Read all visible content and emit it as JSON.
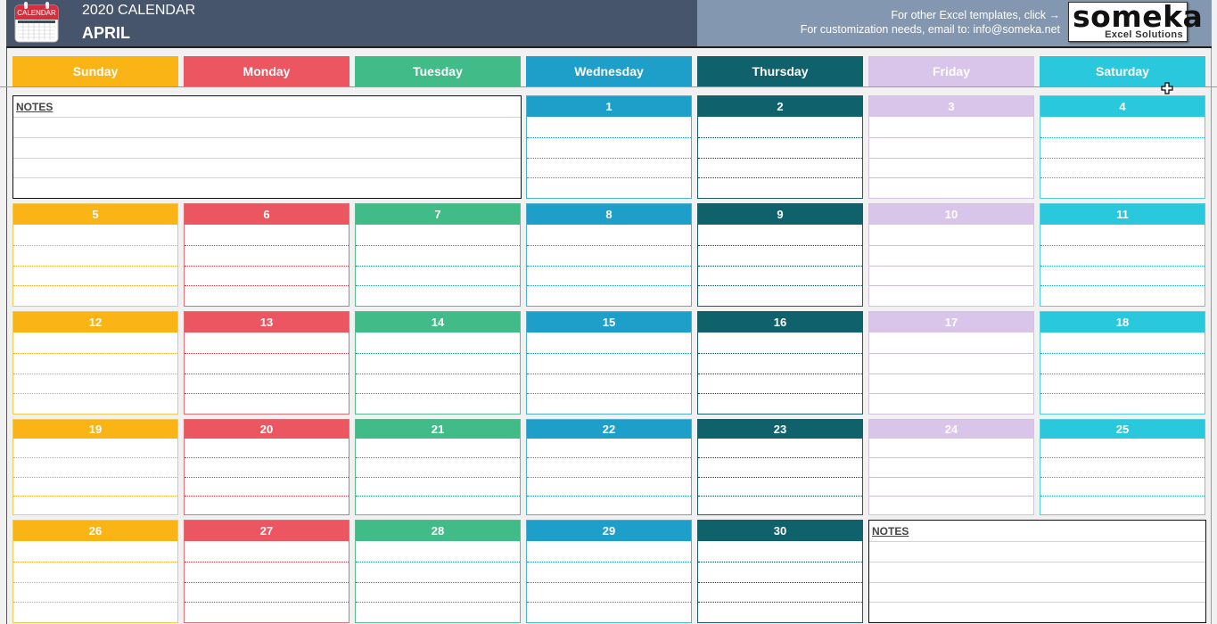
{
  "header": {
    "title": "2020 CALENDAR",
    "month": "APRIL",
    "icon": "calendar-icon",
    "icon_label": "CALENDAR",
    "promo_line1": "For other Excel templates, click →",
    "promo_line2": "For customization needs, email to: info@someka.net",
    "logo_main": "someka",
    "logo_sub": "Excel Solutions"
  },
  "colors": {
    "header_dark": "#46556b",
    "header_light": "#8497b0",
    "sunday": "#fbb416",
    "monday": "#eb5660",
    "tuesday": "#41bb88",
    "wednesday": "#1e9fca",
    "thursday": "#0f626c",
    "friday": "#dac5ea",
    "saturday": "#2ac8dc"
  },
  "weekdays": [
    "Sunday",
    "Monday",
    "Tuesday",
    "Wednesday",
    "Thursday",
    "Friday",
    "Saturday"
  ],
  "notes": {
    "top_label": "NOTES",
    "bottom_label": "NOTES"
  },
  "weeks": [
    [
      "",
      "",
      "",
      "1",
      "2",
      "3",
      "4"
    ],
    [
      "5",
      "6",
      "7",
      "8",
      "9",
      "10",
      "11"
    ],
    [
      "12",
      "13",
      "14",
      "15",
      "16",
      "17",
      "18"
    ],
    [
      "19",
      "20",
      "21",
      "22",
      "23",
      "24",
      "25"
    ],
    [
      "26",
      "27",
      "28",
      "29",
      "30",
      "",
      ""
    ]
  ]
}
